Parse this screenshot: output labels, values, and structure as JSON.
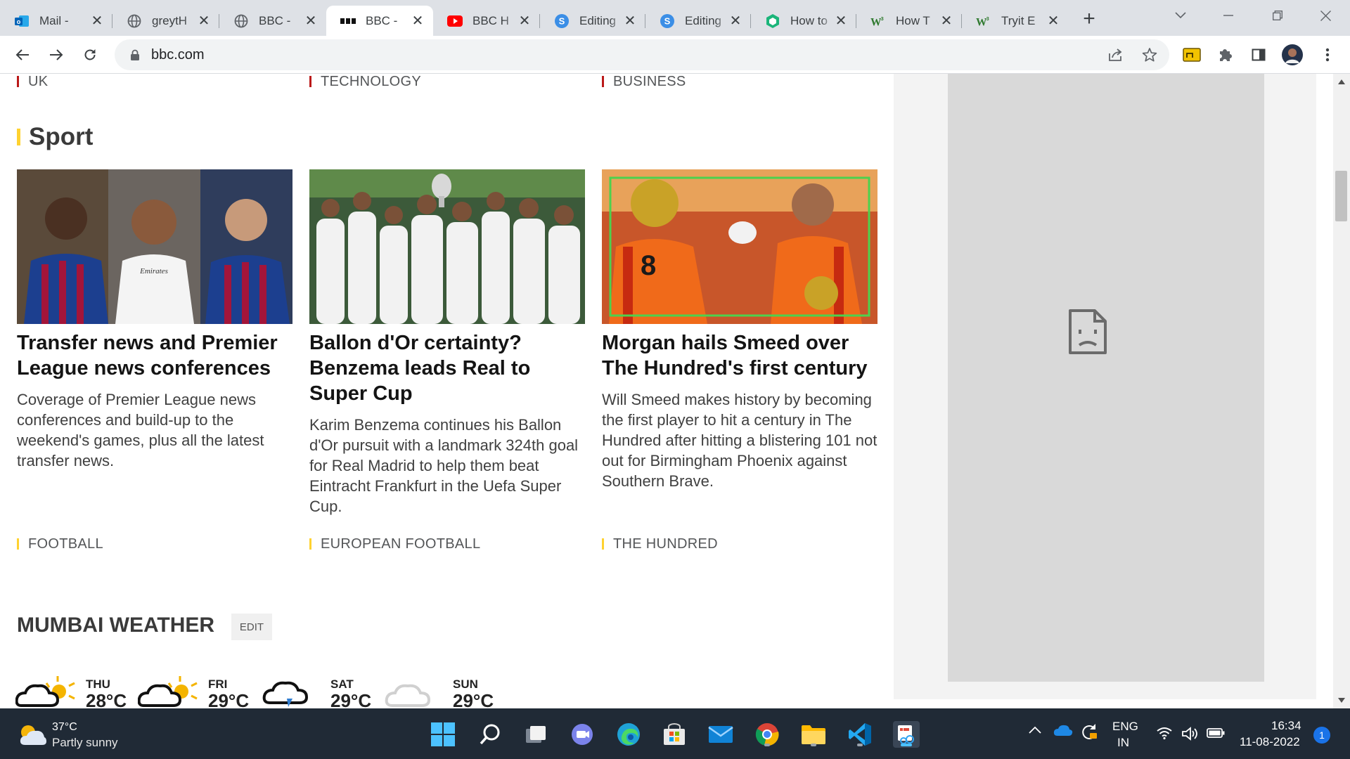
{
  "browser": {
    "tabs": [
      {
        "title": "Mail - ",
        "icon": "outlook-icon"
      },
      {
        "title": "greytH",
        "icon": "globe-icon"
      },
      {
        "title": "BBC - ",
        "icon": "globe-icon"
      },
      {
        "title": "BBC - ",
        "icon": "bbc-icon",
        "active": true
      },
      {
        "title": "BBC H",
        "icon": "youtube-icon"
      },
      {
        "title": "Editing",
        "icon": "editor-icon"
      },
      {
        "title": "Editing",
        "icon": "editor-icon"
      },
      {
        "title": "How to",
        "icon": "shield-icon"
      },
      {
        "title": "How T",
        "icon": "wikihow-icon"
      },
      {
        "title": "Tryit E",
        "icon": "wikihow-icon"
      }
    ],
    "new_tab": "+",
    "url": "bbc.com"
  },
  "page": {
    "top_categories": [
      "UK",
      "TECHNOLOGY",
      "BUSINESS"
    ],
    "section_title": "Sport",
    "articles": [
      {
        "headline": "Transfer news and Premier League news conferences",
        "summary": "Coverage of Premier League news conferences and build-up to the weekend's games, plus all the latest transfer news.",
        "category": "FOOTBALL",
        "image": "footballers-photo"
      },
      {
        "headline": "Ballon d'Or certainty? Benzema leads Real to Super Cup",
        "summary": "Karim Benzema continues his Ballon d'Or pursuit with a landmark 324th goal for Real Madrid to help them beat Eintracht Frankfurt in the Uefa Super Cup.",
        "category": "EUROPEAN FOOTBALL",
        "image": "trophy-celebration-photo"
      },
      {
        "headline": "Morgan hails Smeed over The Hundred's first century",
        "summary": "Will Smeed makes history by becoming the first player to hit a century in The Hundred after hitting a blistering 101 not out for Birmingham Phoenix against Southern Brave.",
        "category": "THE HUNDRED",
        "image": "cricketers-photo"
      }
    ],
    "weather": {
      "title": "MUMBAI WEATHER",
      "edit_label": "EDIT",
      "days": [
        {
          "day": "THU",
          "temp": "28°C",
          "icon": "thunder-sun-icon"
        },
        {
          "day": "FRI",
          "temp": "29°C",
          "icon": "thunder-sun-icon"
        },
        {
          "day": "SAT",
          "temp": "29°C",
          "icon": "thunder-rain-icon"
        },
        {
          "day": "SUN",
          "temp": "29°C",
          "icon": "cloud-icon"
        }
      ]
    }
  },
  "taskbar": {
    "weather_temp": "37°C",
    "weather_desc": "Partly sunny",
    "lang_top": "ENG",
    "lang_bottom": "IN",
    "time": "16:34",
    "date": "11-08-2022",
    "notification_count": "1"
  }
}
